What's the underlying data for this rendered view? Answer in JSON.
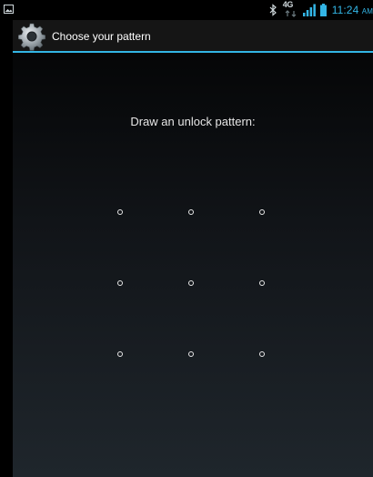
{
  "status_bar": {
    "network_label": "4G",
    "time": "11:24",
    "time_suffix": "AM",
    "accent_color": "#33b5e5",
    "icons": [
      "notification-icon",
      "bluetooth-icon",
      "network-4g-icon",
      "signal-icon",
      "battery-icon"
    ]
  },
  "action_bar": {
    "title": "Choose your pattern",
    "icon": "settings-gear-icon",
    "underline_color": "#33b5e5"
  },
  "pattern_screen": {
    "header": "Draw an unlock pattern:",
    "grid_rows": 3,
    "grid_cols": 3,
    "dots": [
      {
        "id": 1
      },
      {
        "id": 2
      },
      {
        "id": 3
      },
      {
        "id": 4
      },
      {
        "id": 5
      },
      {
        "id": 6
      },
      {
        "id": 7
      },
      {
        "id": 8
      },
      {
        "id": 9
      }
    ]
  }
}
